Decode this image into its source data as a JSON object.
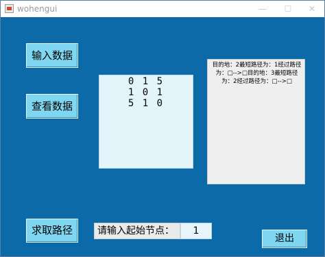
{
  "window": {
    "title": "wohengui",
    "minimize_glyph": "—",
    "maximize_glyph": "☐",
    "close_glyph": "✕"
  },
  "buttons": {
    "input_data": "输入数据",
    "view_data": "查看数据",
    "find_path": "求取路径",
    "exit": "退出"
  },
  "matrix": {
    "rows": [
      "0 1 5",
      "1 0 1",
      "5 1 0"
    ]
  },
  "result": {
    "text": "目的地：2最短路径为：1经过路径为：□-->□目的地：3最短路径为：2经过路径为：□-->□"
  },
  "start_node": {
    "label": "请输入起始节点：",
    "value": "1"
  },
  "colors": {
    "background": "#0d6aa8",
    "button": "#7fd6f0",
    "matrix_panel": "#e3f4fb",
    "result_panel": "#efefef"
  }
}
